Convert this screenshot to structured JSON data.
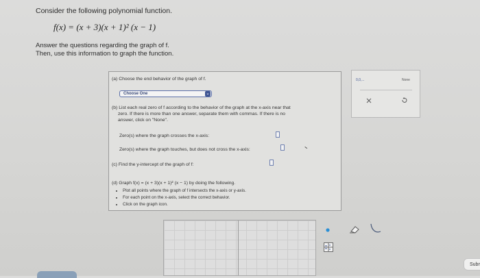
{
  "intro": "Consider the following polynomial function.",
  "function_display": "f(x) = (x + 3)(x + 1)² (x − 1)",
  "instructions": {
    "line1": "Answer the questions regarding the graph of f.",
    "line2": "Then, use this information to graph the function."
  },
  "part_a": {
    "label": "(a) Choose the end behavior of the graph of f.",
    "dropdown_value": "Choose One"
  },
  "part_b": {
    "label": "(b) List each real zero of f according to the behavior of the graph at the x-axis near that",
    "line2": "zero. If there is more than one answer, separate them with commas. If there is no",
    "line3": "answer, click on \"None\".",
    "crosses_label": "Zero(s) where the graph crosses the x-axis:",
    "touches_label": "Zero(s) where the graph touches, but does not cross the x-axis:"
  },
  "part_c": {
    "label": "(c) Find the y-intercept of the graph of f:"
  },
  "part_d": {
    "label": "(d) Graph f(x) = (x + 3)(x + 1)² (x − 1) by doing the following.",
    "bullets": [
      "Plot all points where the graph of f intersects the x-axis or y-axis.",
      "For each point on the x-axis, select the correct behavior.",
      "Click on the graph icon."
    ]
  },
  "toolbar": {
    "comma_label": "0,0,...",
    "none_label": "None"
  },
  "submit_label": "Subm",
  "colors": {
    "accent": "#3f5593",
    "point": "#2a8fd6",
    "background": "#d8d8d6"
  }
}
